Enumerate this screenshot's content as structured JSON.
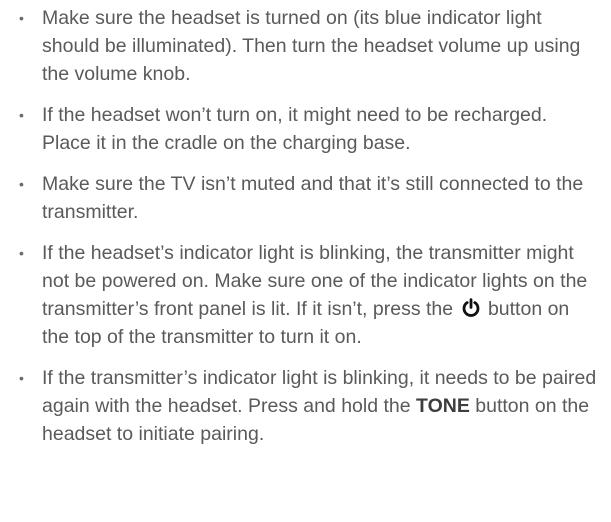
{
  "bullet_glyph": "•",
  "icons": {
    "power": "power-icon"
  },
  "items": [
    {
      "text": "Make sure the headset is turned on (its blue indicator light should be illuminated). Then turn the headset volume up using the volume knob."
    },
    {
      "text": "If the headset won’t turn on, it might need to be recharged. Place it in the cradle on the charging base."
    },
    {
      "text": "Make sure the TV isn’t muted and that it’s still connected to the transmitter."
    },
    {
      "text_before": "If the headset’s indicator light is blinking, the transmitter might not be powered on. Make sure one of the indicator lights on the transmitter’s front panel is lit. If it isn’t, press the ",
      "text_after": " button on the top of the transmitter to turn it on."
    },
    {
      "text_before": "If the transmitter’s indicator light is blinking, it needs to be paired again with the headset. Press and hold the ",
      "bold": "TONE",
      "text_after": " button on the headset to initiate pairing."
    }
  ]
}
